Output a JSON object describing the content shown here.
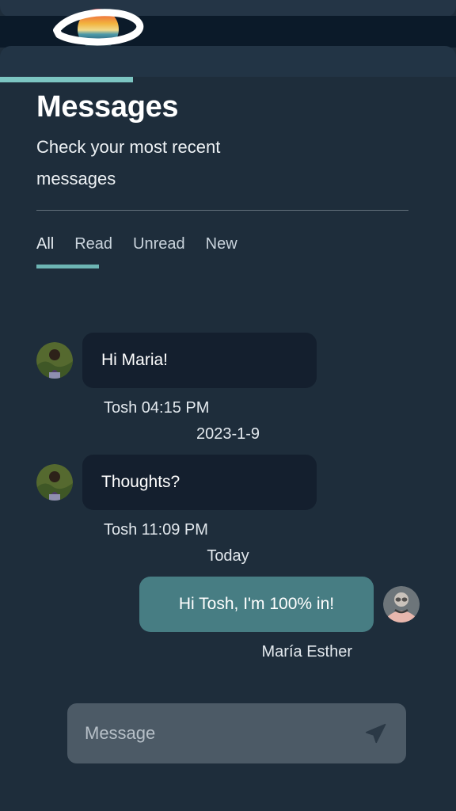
{
  "app": {
    "logo_icon": "saturn-planet-logo",
    "progress_percent": 29
  },
  "header": {
    "title": "Messages",
    "subtitle": "Check your most recent messages"
  },
  "tabs": [
    {
      "label": "All",
      "active": true
    },
    {
      "label": "Read",
      "active": false
    },
    {
      "label": "Unread",
      "active": false
    },
    {
      "label": "New",
      "active": false
    }
  ],
  "thread": [
    {
      "kind": "message",
      "direction": "in",
      "text": "Hi Maria!",
      "meta": "Tosh 04:15 PM",
      "avatar_icon": "avatar-tosh"
    },
    {
      "kind": "daystamp",
      "text": "2023-1-9"
    },
    {
      "kind": "message",
      "direction": "in",
      "text": "Thoughts?",
      "meta": "Tosh 11:09 PM",
      "avatar_icon": "avatar-tosh"
    },
    {
      "kind": "daystamp",
      "text": "Today"
    },
    {
      "kind": "message",
      "direction": "out",
      "text": "Hi Tosh, I'm 100% in!",
      "meta": "María Esther",
      "avatar_icon": "avatar-maria-esther"
    }
  ],
  "composer": {
    "value": "",
    "placeholder": "Message",
    "send_icon": "send-paper-plane-icon"
  },
  "colors": {
    "page_background": "#1e2d3b",
    "browser_band": "#0b1a29",
    "panel": "#223445",
    "accent_teal": "#7cc5c2",
    "tab_underline": "#6db5b4",
    "bubble_incoming": "#141f2e",
    "bubble_outgoing": "#477d83",
    "composer_background": "#4c5a66",
    "text_primary": "#ffffff",
    "text_secondary": "#c9d3dc"
  }
}
